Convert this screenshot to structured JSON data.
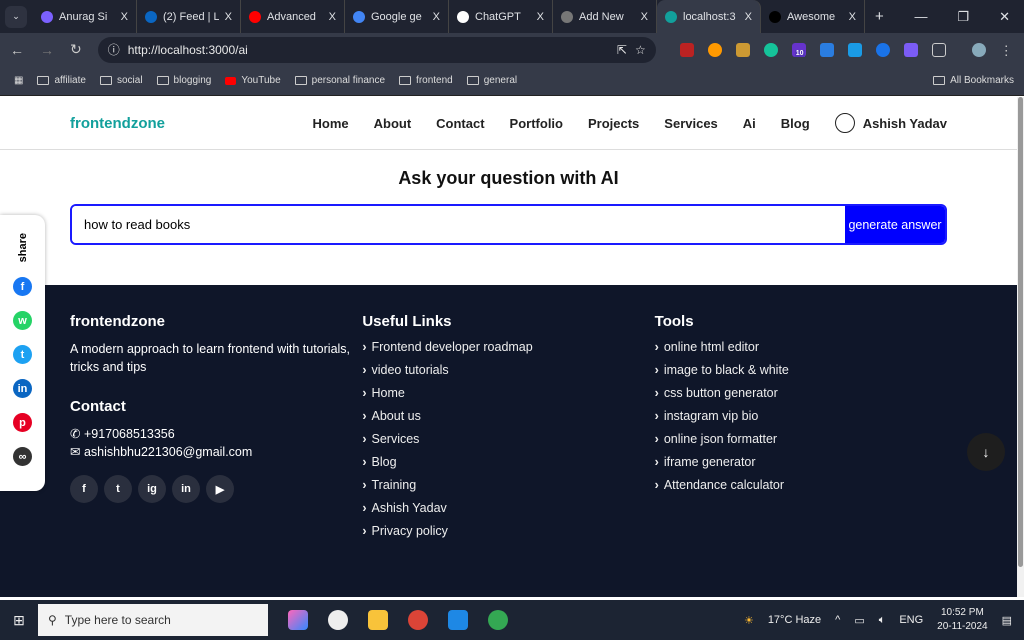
{
  "browser": {
    "tabs": [
      {
        "title": "Anurag Si",
        "color": "#7b61ff"
      },
      {
        "title": "(2) Feed | L",
        "color": "#0a66c2"
      },
      {
        "title": "Advanced",
        "color": "#ff0000"
      },
      {
        "title": "Google ge",
        "color": "#4285f4"
      },
      {
        "title": "ChatGPT",
        "color": "#ffffff"
      },
      {
        "title": "Add New",
        "color": "#777777"
      },
      {
        "title": "localhost:3",
        "color": "#12a09c",
        "active": true
      },
      {
        "title": "Awesome",
        "color": "#000000"
      }
    ],
    "close": "X",
    "new_tab": "+",
    "url": "http://localhost:3000/ai",
    "bookmarks": [
      "affiliate",
      "social",
      "blogging",
      "YouTube",
      "personal finance",
      "frontend",
      "general"
    ],
    "all_bookmarks": "All Bookmarks",
    "extension_badge": "10"
  },
  "nav": {
    "logo": "frontendzone",
    "links": [
      "Home",
      "About",
      "Contact",
      "Portfolio",
      "Projects",
      "Services",
      "Ai",
      "Blog"
    ],
    "user": "Ashish Yadav"
  },
  "main": {
    "title": "Ask your question with AI",
    "input_value": "how to read books",
    "button": "generate answer"
  },
  "share": {
    "label": "share",
    "icons": [
      {
        "name": "facebook",
        "color": "#1877f2",
        "glyph": "f"
      },
      {
        "name": "whatsapp",
        "color": "#25d366",
        "glyph": "w"
      },
      {
        "name": "twitter",
        "color": "#1da1f2",
        "glyph": "t"
      },
      {
        "name": "linkedin",
        "color": "#0a66c2",
        "glyph": "in"
      },
      {
        "name": "pinterest",
        "color": "#e60023",
        "glyph": "p"
      },
      {
        "name": "link",
        "color": "#333333",
        "glyph": "∞"
      }
    ]
  },
  "footer": {
    "brand": "frontendzone",
    "tagline": "A modern approach to learn frontend with tutorials, tricks and tips",
    "contact_title": "Contact",
    "phone": "+917068513356",
    "email": "ashishbhu221306@gmail.com",
    "social": [
      "f",
      "t",
      "ig",
      "in",
      "▶"
    ],
    "useful_title": "Useful Links",
    "useful": [
      "Frontend developer roadmap",
      "video tutorials",
      "Home",
      "About us",
      "Services",
      "Blog",
      "Training",
      "Ashish Yadav",
      "Privacy policy"
    ],
    "tools_title": "Tools",
    "tools": [
      "online html editor",
      "image to black & white",
      "css button generator",
      "instagram vip bio",
      "online json formatter",
      "iframe generator",
      "Attendance calculator"
    ]
  },
  "taskbar": {
    "search": "Type here to search",
    "weather": "17°C  Haze",
    "lang": "ENG",
    "time": "10:52 PM",
    "date": "20-11-2024"
  }
}
